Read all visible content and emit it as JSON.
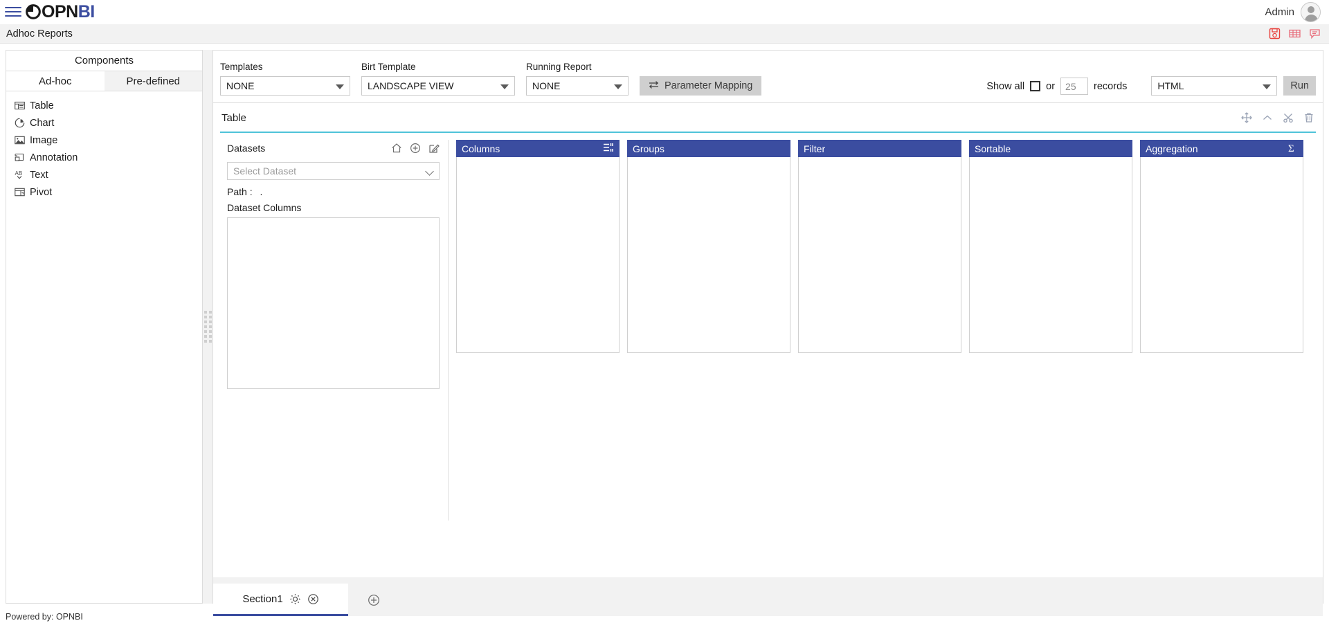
{
  "app": {
    "logo_dark": "OPN",
    "logo_blue": "BI",
    "hamburger_icon": "hamburger-menu-icon",
    "user_label": "Admin",
    "avatar_icon": "user-avatar-icon"
  },
  "subheader": {
    "page_title": "Adhoc Reports",
    "icons": [
      {
        "name": "save-report-icon",
        "color": "#e8413c"
      },
      {
        "name": "table-view-icon",
        "color": "#e86c7a"
      },
      {
        "name": "comment-icon",
        "color": "#e86c7a"
      }
    ]
  },
  "sidebar": {
    "title": "Components",
    "tabs": [
      {
        "label": "Ad-hoc",
        "active": true
      },
      {
        "label": "Pre-defined",
        "active": false
      }
    ],
    "items": [
      {
        "label": "Table",
        "icon": "table-icon"
      },
      {
        "label": "Chart",
        "icon": "pie-chart-icon"
      },
      {
        "label": "Image",
        "icon": "image-icon"
      },
      {
        "label": "Annotation",
        "icon": "annotation-icon"
      },
      {
        "label": "Text",
        "icon": "text-ab-icon"
      },
      {
        "label": "Pivot",
        "icon": "pivot-icon"
      }
    ],
    "footer": "Powered by: OPNBI"
  },
  "toolbar": {
    "templates": {
      "label": "Templates",
      "value": "NONE"
    },
    "birt_template": {
      "label": "Birt Template",
      "value": "LANDSCAPE VIEW"
    },
    "running_report": {
      "label": "Running Report",
      "value": "NONE"
    },
    "parameter_mapping": {
      "label": "Parameter Mapping",
      "icon": "swap-arrows-icon"
    },
    "show_all_label": "Show all",
    "or_label": "or",
    "records_value": "25",
    "records_label": "records",
    "format": {
      "value": "HTML"
    },
    "run_label": "Run"
  },
  "widget": {
    "title": "Table",
    "tools": [
      {
        "name": "move-icon"
      },
      {
        "name": "collapse-chevron-up-icon"
      },
      {
        "name": "settings-tools-icon"
      },
      {
        "name": "delete-trash-icon"
      }
    ],
    "datasets": {
      "label": "Datasets",
      "icons": [
        {
          "name": "home-icon"
        },
        {
          "name": "add-circle-icon"
        },
        {
          "name": "edit-pencil-icon"
        }
      ],
      "select_placeholder": "Select Dataset",
      "path_label": "Path :",
      "path_value": ".",
      "columns_label": "Dataset Columns"
    },
    "drop_panels": [
      {
        "label": "Columns",
        "icon": "list-settings-icon"
      },
      {
        "label": "Groups",
        "icon": ""
      },
      {
        "label": "Filter",
        "icon": ""
      },
      {
        "label": "Sortable",
        "icon": ""
      },
      {
        "label": "Aggregation",
        "icon": "sigma-icon"
      }
    ]
  },
  "sections": {
    "tab_label": "Section1",
    "tab_settings_icon": "gear-icon",
    "tab_close_icon": "close-circle-icon",
    "add_icon": "add-circle-icon"
  },
  "colors": {
    "brand_blue": "#3b4da0",
    "panel_header": "#3b4da0",
    "accent_teal": "#4fc3d9",
    "red_icon": "#e8413c"
  }
}
